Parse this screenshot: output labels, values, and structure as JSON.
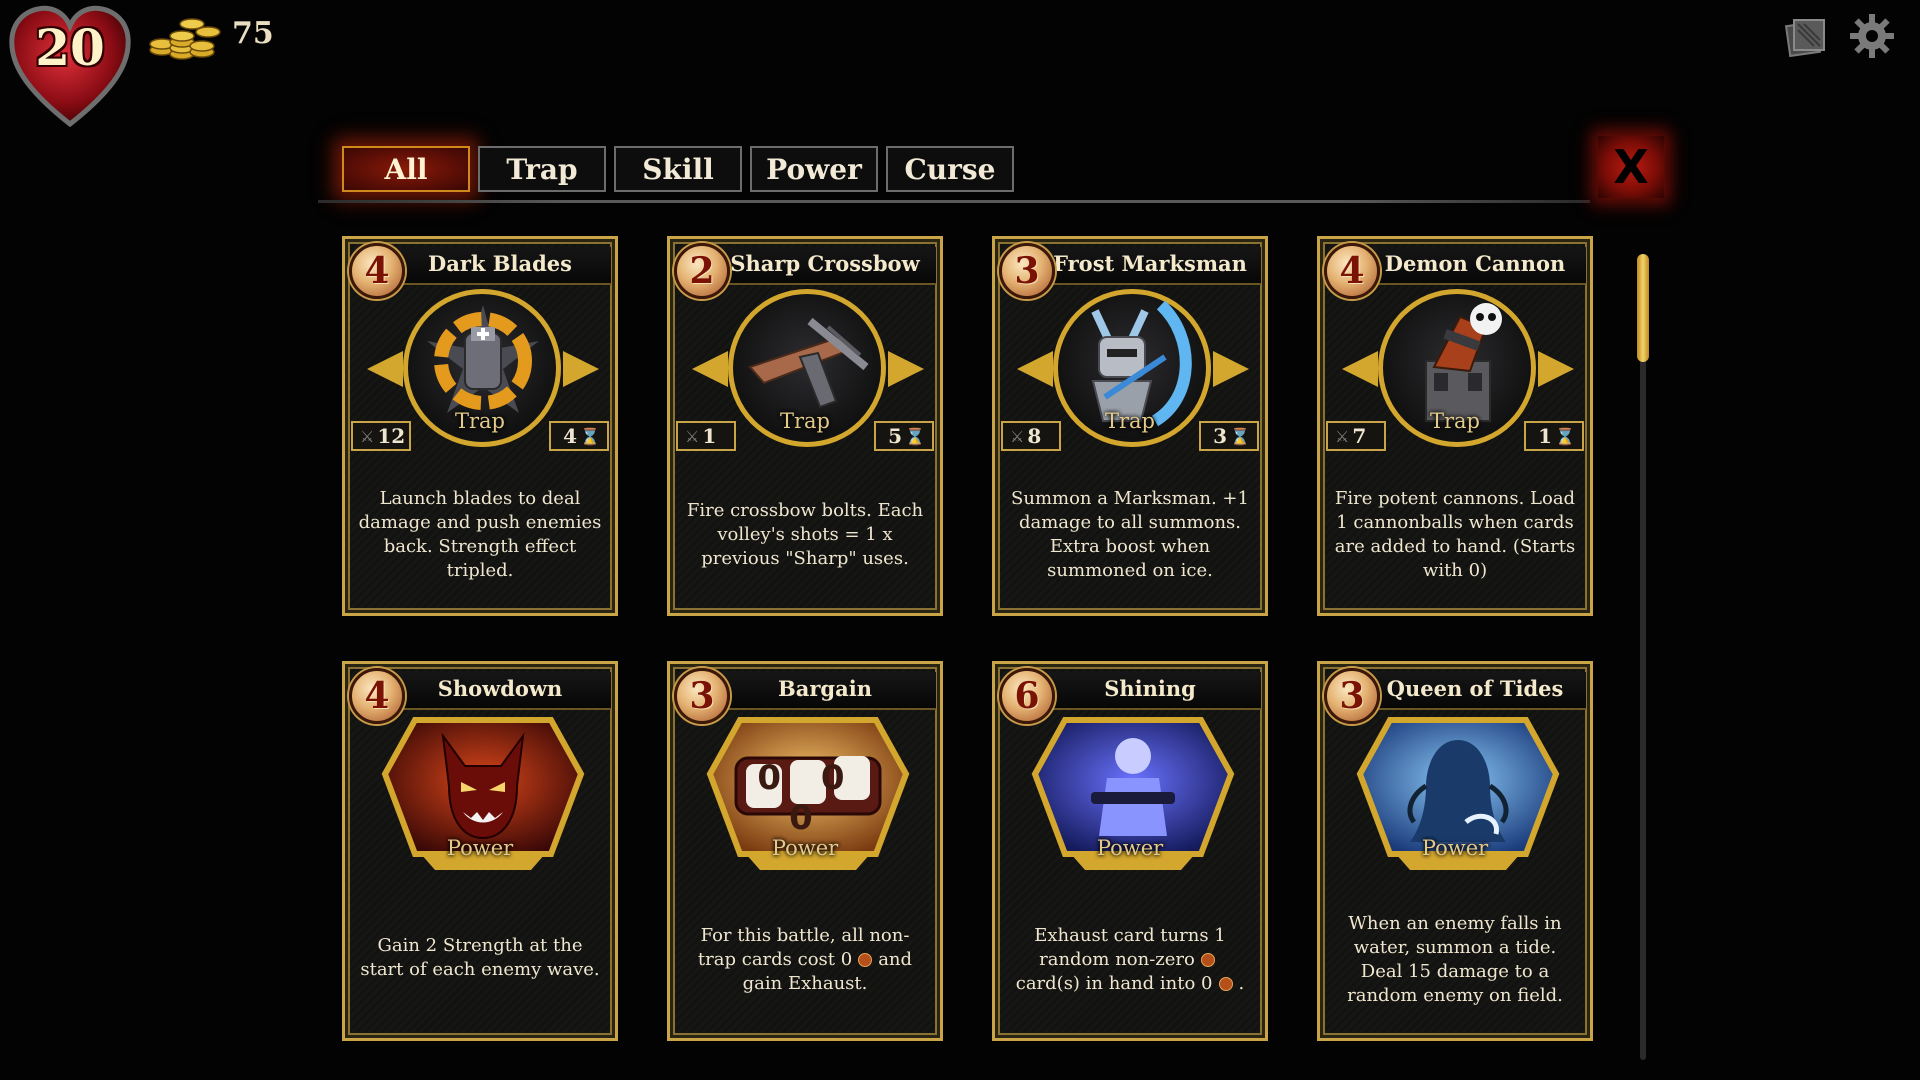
{
  "hud": {
    "hp": "20",
    "gold": "75",
    "icons": [
      "heart-icon",
      "coins-icon",
      "deck-icon",
      "gear-icon"
    ]
  },
  "tabs": [
    {
      "label": "All",
      "active": true
    },
    {
      "label": "Trap",
      "active": false
    },
    {
      "label": "Skill",
      "active": false
    },
    {
      "label": "Power",
      "active": false
    },
    {
      "label": "Curse",
      "active": false
    }
  ],
  "close_label": "X",
  "colors": {
    "accent_gold": "#c9a548",
    "active_tab": "#7e1208",
    "close_red": "#b81b10"
  },
  "cards": [
    {
      "cost": "4",
      "name": "Dark Blades",
      "type": "Trap",
      "attack": "12",
      "duration": "4",
      "desc_lines": [
        "Launch blades to deal",
        "damage and push enemies",
        "back. Strength effect",
        "tripled."
      ],
      "art": "spinning-blades-icon"
    },
    {
      "cost": "2",
      "name": "Sharp Crossbow",
      "type": "Trap",
      "attack": "1",
      "duration": "5",
      "desc_lines": [
        "Fire crossbow bolts. Each",
        "volley's shots = 1 x",
        "previous \"Sharp\" uses."
      ],
      "art": "crossbow-icon"
    },
    {
      "cost": "3",
      "name": "Frost Marksman",
      "type": "Trap",
      "attack": "8",
      "duration": "3",
      "desc_lines": [
        "Summon a Marksman. +1",
        "damage to all summons.",
        "Extra boost when",
        "summoned on ice."
      ],
      "art": "frost-archer-icon"
    },
    {
      "cost": "4",
      "name": "Demon Cannon",
      "type": "Trap",
      "attack": "7",
      "duration": "1",
      "desc_lines": [
        "Fire potent cannons. Load",
        "1 cannonballs when cards",
        "are added to hand. (Starts",
        "with 0)"
      ],
      "art": "cannon-icon"
    },
    {
      "cost": "4",
      "name": "Showdown",
      "type": "Power",
      "desc_lines": [
        "Gain 2 Strength at the",
        "start of each enemy wave."
      ],
      "art": "demon-face-icon"
    },
    {
      "cost": "3",
      "name": "Bargain",
      "type": "Power",
      "desc_lines": [
        "For this battle, all non-",
        "trap cards cost 0",
        "gain Exhaust."
      ],
      "desc_suffix": "and",
      "art": "counter-000-icon",
      "counter": "0 0 0"
    },
    {
      "cost": "6",
      "name": "Shining",
      "type": "Power",
      "desc_lines": [
        "Exhaust card turns 1",
        "random non-zero",
        "card(s) in hand into 0"
      ],
      "art": "glowing-figure-icon"
    },
    {
      "cost": "3",
      "name": "Queen of Tides",
      "type": "Power",
      "desc_lines": [
        "When an enemy falls in",
        "water, summon a tide.",
        "Deal 15 damage to a",
        "random enemy on field."
      ],
      "art": "sea-queen-icon"
    }
  ]
}
